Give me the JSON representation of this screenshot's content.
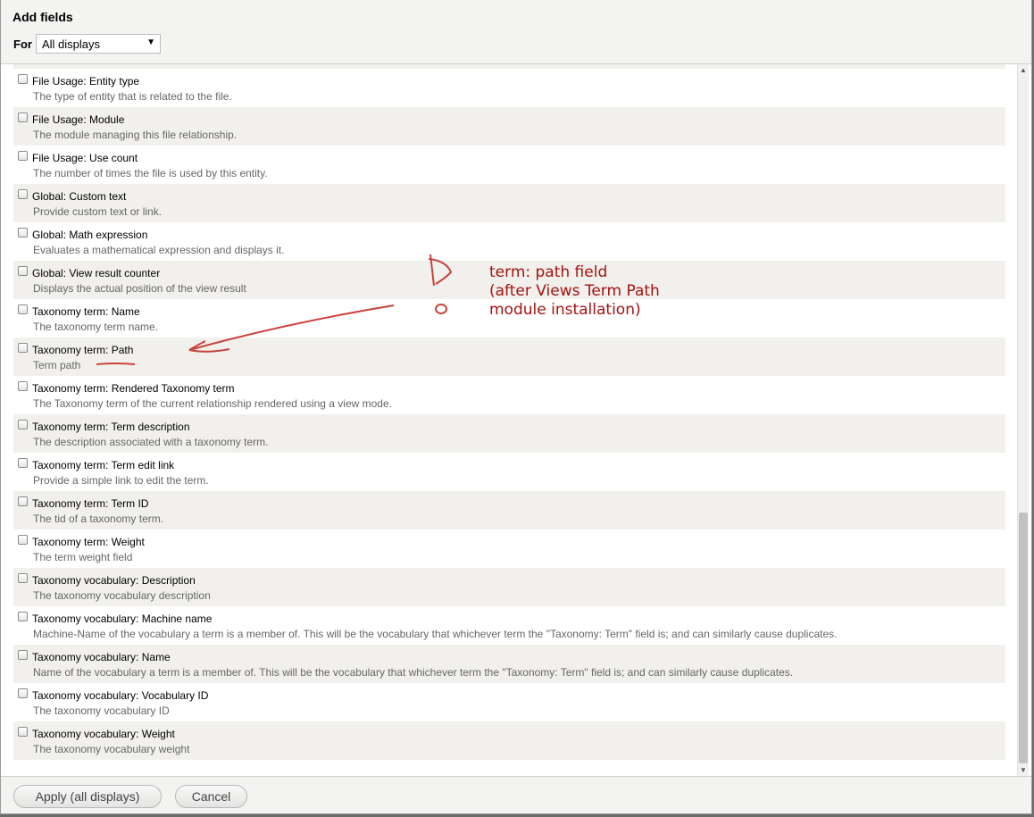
{
  "dialog": {
    "title": "Add fields",
    "for_label": "For",
    "display_select": "All displays"
  },
  "fields": [
    {
      "name": "File Usage: Entity type",
      "desc": "The type of entity that is related to the file."
    },
    {
      "name": "File Usage: Module",
      "desc": "The module managing this file relationship."
    },
    {
      "name": "File Usage: Use count",
      "desc": "The number of times the file is used by this entity."
    },
    {
      "name": "Global: Custom text",
      "desc": "Provide custom text or link."
    },
    {
      "name": "Global: Math expression",
      "desc": "Evaluates a mathematical expression and displays it."
    },
    {
      "name": "Global: View result counter",
      "desc": "Displays the actual position of the view result"
    },
    {
      "name": "Taxonomy term: Name",
      "desc": "The taxonomy term name."
    },
    {
      "name": "Taxonomy term: Path",
      "desc": "Term path"
    },
    {
      "name": "Taxonomy term: Rendered Taxonomy term",
      "desc": "The Taxonomy term of the current relationship rendered using a view mode."
    },
    {
      "name": "Taxonomy term: Term description",
      "desc": "The description associated with a taxonomy term."
    },
    {
      "name": "Taxonomy term: Term edit link",
      "desc": "Provide a simple link to edit the term."
    },
    {
      "name": "Taxonomy term: Term ID",
      "desc": "The tid of a taxonomy term."
    },
    {
      "name": "Taxonomy term: Weight",
      "desc": "The term weight field"
    },
    {
      "name": "Taxonomy vocabulary: Description",
      "desc": "The taxonomy vocabulary description"
    },
    {
      "name": "Taxonomy vocabulary: Machine name",
      "desc": "Machine-Name of the vocabulary a term is a member of. This will be the vocabulary that whichever term the \"Taxonomy: Term\" field is; and can similarly cause duplicates."
    },
    {
      "name": "Taxonomy vocabulary: Name",
      "desc": "Name of the vocabulary a term is a member of. This will be the vocabulary that whichever term the \"Taxonomy: Term\" field is; and can similarly cause duplicates."
    },
    {
      "name": "Taxonomy vocabulary: Vocabulary ID",
      "desc": "The taxonomy vocabulary ID"
    },
    {
      "name": "Taxonomy vocabulary: Weight",
      "desc": "The taxonomy vocabulary weight"
    }
  ],
  "footer": {
    "apply_label": "Apply (all displays)",
    "cancel_label": "Cancel"
  },
  "annotation": {
    "line1": "term: path field",
    "line2": "(after Views Term Path",
    "line3": "module installation)",
    "color": "#a5120e"
  }
}
